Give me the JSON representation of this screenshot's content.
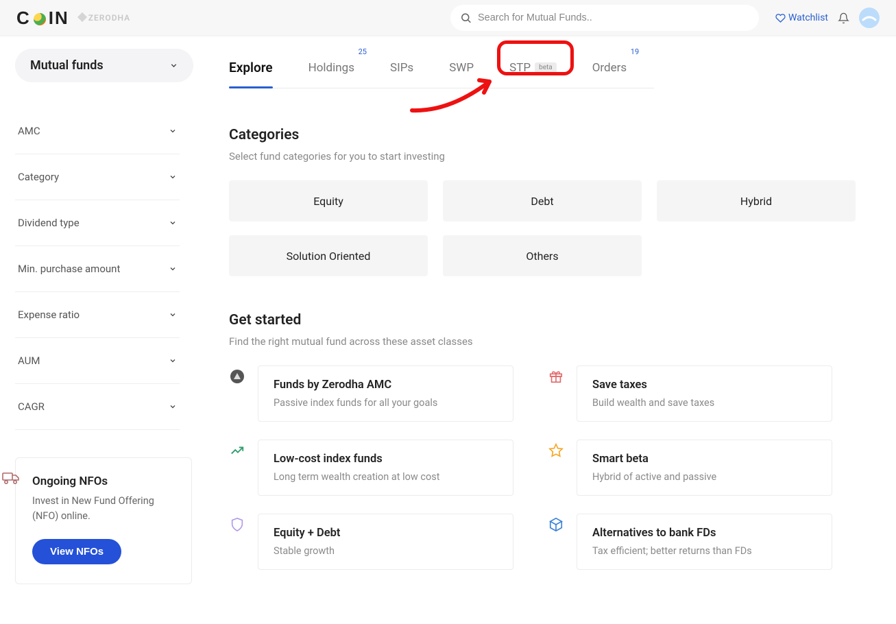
{
  "header": {
    "logo_brand": "ZERODHA",
    "search_placeholder": "Search for Mutual Funds..",
    "watchlist_label": "Watchlist"
  },
  "sidebar": {
    "dropdown_label": "Mutual funds",
    "filters": [
      {
        "label": "AMC"
      },
      {
        "label": "Category"
      },
      {
        "label": "Dividend type"
      },
      {
        "label": "Min. purchase amount"
      },
      {
        "label": "Expense ratio"
      },
      {
        "label": "AUM"
      },
      {
        "label": "CAGR"
      }
    ],
    "nfo": {
      "title": "Ongoing NFOs",
      "desc": "Invest in New Fund Offering (NFO) online.",
      "cta": "View NFOs"
    }
  },
  "tabs": [
    {
      "label": "Explore",
      "active": true
    },
    {
      "label": "Holdings",
      "badge": "25"
    },
    {
      "label": "SIPs"
    },
    {
      "label": "SWP"
    },
    {
      "label": "STP",
      "beta": "beta"
    },
    {
      "label": "Orders",
      "badge": "19"
    }
  ],
  "categories": {
    "title": "Categories",
    "subtitle": "Select fund categories for you to start investing",
    "items": [
      "Equity",
      "Debt",
      "Hybrid",
      "Solution Oriented",
      "Others"
    ]
  },
  "get_started": {
    "title": "Get started",
    "subtitle": "Find the right mutual fund across these asset classes",
    "items": [
      {
        "icon": "zerodha",
        "title": "Funds by Zerodha AMC",
        "desc": "Passive index funds for all your goals"
      },
      {
        "icon": "gift",
        "title": "Save taxes",
        "desc": "Build wealth and save taxes"
      },
      {
        "icon": "trend",
        "title": "Low-cost index funds",
        "desc": "Long term wealth creation at low cost"
      },
      {
        "icon": "star",
        "title": "Smart beta",
        "desc": "Hybrid of active and passive"
      },
      {
        "icon": "shield",
        "title": "Equity + Debt",
        "desc": "Stable growth"
      },
      {
        "icon": "cube",
        "title": "Alternatives to bank FDs",
        "desc": "Tax efficient; better returns than FDs"
      }
    ]
  }
}
